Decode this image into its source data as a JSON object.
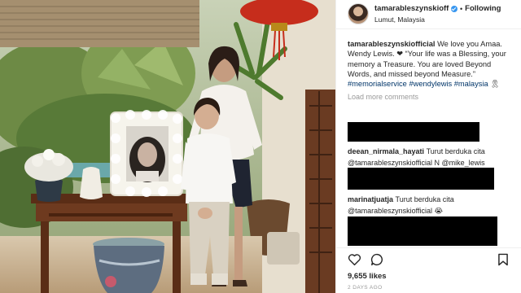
{
  "post": {
    "username": "tamarableszynskiofficial",
    "username_shown": "tamarableszynskioffici…",
    "verified": true,
    "separator": "•",
    "follow_label": "Following",
    "location": "Lumut, Malaysia",
    "caption_user": "tamarableszynskiofficial",
    "caption_text": "We love you Amaa. Wendy Lewis. ❤ “Your life was a Blessing, your memory a Treasure. You are loved Beyond Words, and missed beyond Measure.”",
    "hashtags": [
      "#memorialservice",
      "#wendylewis",
      "#malaysia"
    ],
    "caption_end": "🎗",
    "load_more": "Load more comments"
  },
  "comments": [
    {
      "user": "deean_nirmala_hayati",
      "text": "Turut berduka cita",
      "line2_mention1": "@tamarableszynskiofficial",
      "line2_mid": " N ",
      "line2_mention2": "@mike_lewis"
    },
    {
      "user": "marinatjuatja",
      "text": "Turut berduka cita",
      "line2_mention1": "@tamarableszynskiofficial",
      "line2_end": " 😭"
    }
  ],
  "stats": {
    "likes": "9,655 likes",
    "time_ago": "2 DAYS AGO"
  },
  "icons": [
    "heart-icon",
    "comment-icon",
    "bookmark-icon",
    "verified-badge-icon"
  ],
  "colors": {
    "link": "#003569",
    "verified": "#3897f0",
    "muted": "#999999",
    "text": "#262626"
  }
}
